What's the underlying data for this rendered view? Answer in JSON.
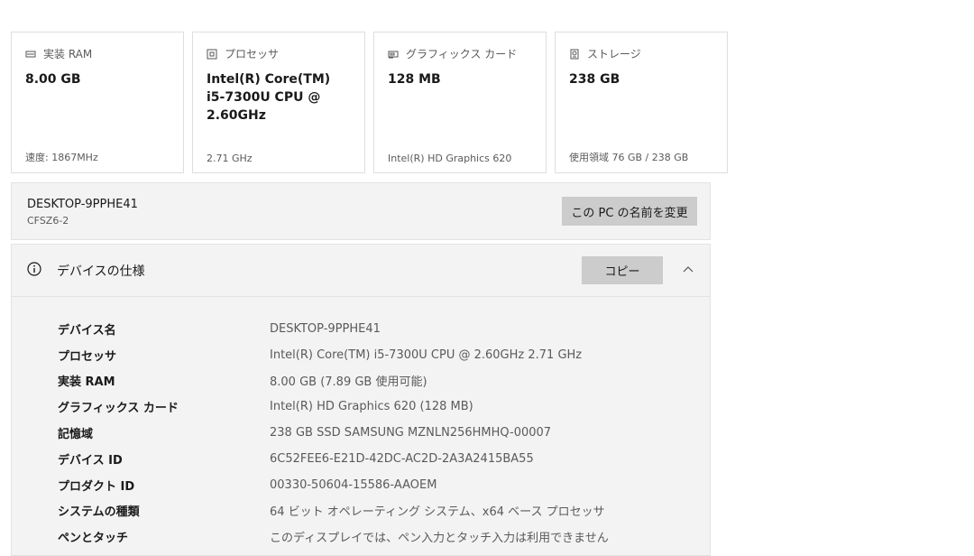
{
  "cards": [
    {
      "icon": "ram-icon",
      "title": "実装 RAM",
      "value": "8.00 GB",
      "footer": "速度: 1867MHz"
    },
    {
      "icon": "processor-icon",
      "title": "プロセッサ",
      "value": "Intel(R) Core(TM)\ni5-7300U CPU @\n2.60GHz",
      "footer": "2.71 GHz"
    },
    {
      "icon": "graphics-card-icon",
      "title": "グラフィックス カード",
      "value": "128 MB",
      "footer": "Intel(R) HD Graphics 620"
    },
    {
      "icon": "storage-icon",
      "title": "ストレージ",
      "value": "238 GB",
      "footer": "使用領域 76 GB / 238 GB"
    }
  ],
  "pc": {
    "name": "DESKTOP-9PPHE41",
    "model": "CFSZ6-2",
    "rename_label": "この PC の名前を変更"
  },
  "spec": {
    "icon": "info-icon",
    "title": "デバイスの仕様",
    "copy_label": "コピー",
    "collapse_icon": "chevron-up-icon",
    "rows": [
      {
        "label": "デバイス名",
        "value": "DESKTOP-9PPHE41"
      },
      {
        "label": "プロセッサ",
        "value": "Intel(R) Core(TM) i5-7300U CPU @ 2.60GHz   2.71 GHz"
      },
      {
        "label": "実装 RAM",
        "value": "8.00 GB (7.89 GB 使用可能)"
      },
      {
        "label": "グラフィックス カード",
        "value": "Intel(R) HD Graphics 620 (128 MB)"
      },
      {
        "label": "記憶域",
        "value": "238 GB SSD SAMSUNG MZNLN256HMHQ-00007"
      },
      {
        "label": "デバイス ID",
        "value": "6C52FEE6-E21D-42DC-AC2D-2A3A2415BA55"
      },
      {
        "label": "プロダクト ID",
        "value": "00330-50604-15586-AAOEM"
      },
      {
        "label": "システムの種類",
        "value": "64 ビット オペレーティング システム、x64 ベース プロセッサ"
      },
      {
        "label": "ペンとタッチ",
        "value": "このディスプレイでは、ペン入力とタッチ入力は利用できません"
      }
    ]
  }
}
